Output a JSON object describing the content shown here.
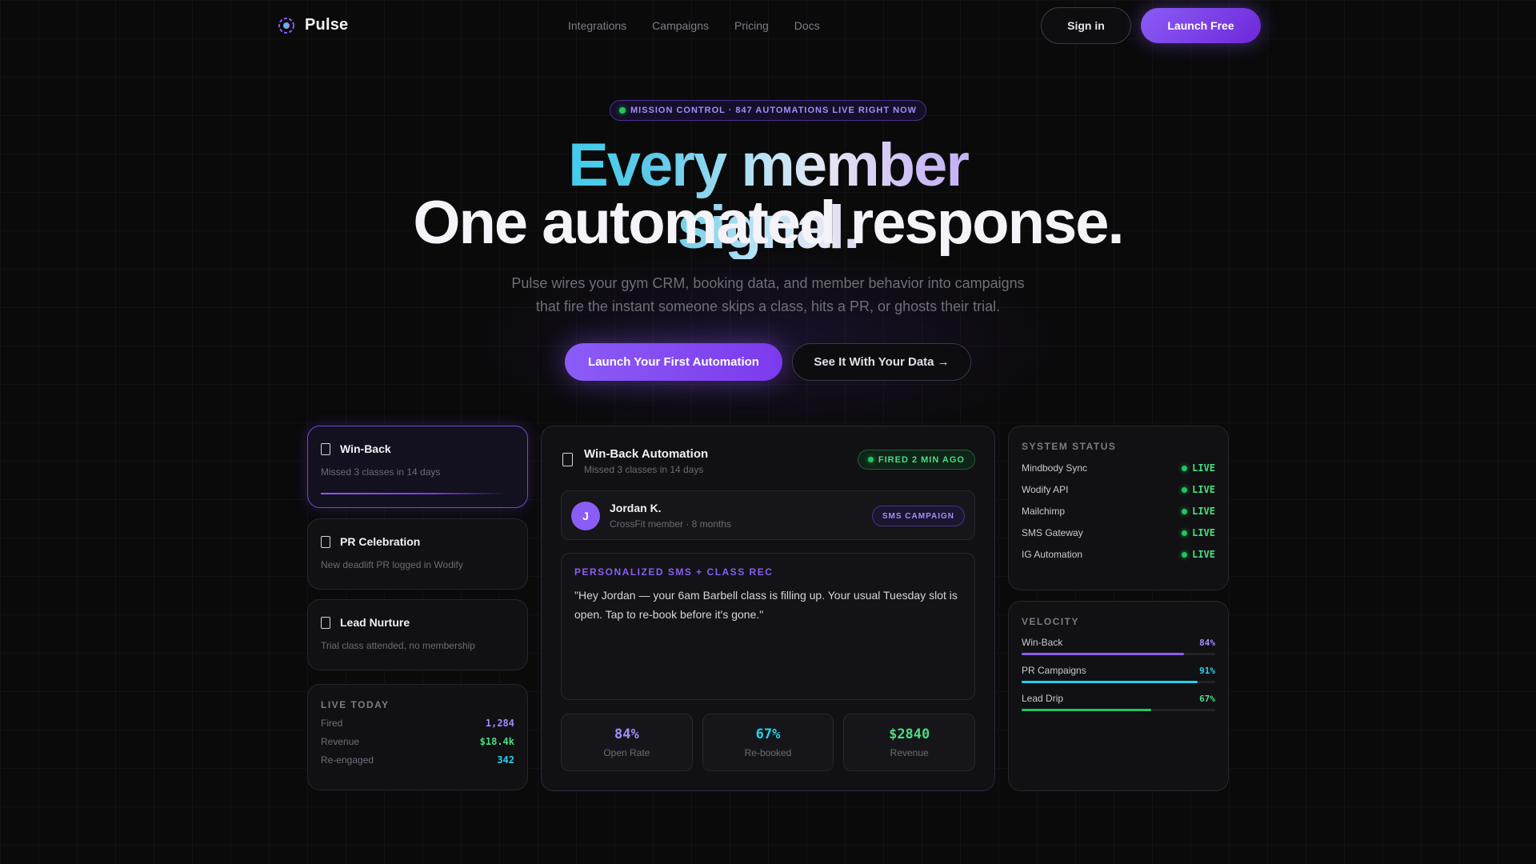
{
  "brand": {
    "name": "Pulse"
  },
  "nav": {
    "links": [
      "Integrations",
      "Campaigns",
      "Pricing",
      "Docs"
    ],
    "sign_in": "Sign in",
    "launch": "Launch Free"
  },
  "hero": {
    "badge": "MISSION CONTROL · 847 AUTOMATIONS LIVE RIGHT NOW",
    "headline_line1": "Every member signal.",
    "headline_line2": "One automated response.",
    "subtitle_line1": "Pulse wires your gym CRM, booking data, and member behavior into campaigns",
    "subtitle_line2": "that fire the instant someone skips a class, hits a PR, or ghosts their trial.",
    "cta_primary": "Launch Your First Automation",
    "cta_secondary": "See It With Your Data →"
  },
  "triggers": [
    {
      "title": "Win-Back",
      "desc": "Missed 3 classes in 14 days",
      "active": true
    },
    {
      "title": "PR Celebration",
      "desc": "New deadlift PR logged in Wodify",
      "active": false
    },
    {
      "title": "Lead Nurture",
      "desc": "Trial class attended, no membership",
      "active": false
    }
  ],
  "live_today": {
    "label": "LIVE TODAY",
    "rows": [
      {
        "label": "Fired",
        "value": "1,284",
        "color": "#a78bfa"
      },
      {
        "label": "Revenue",
        "value": "$18.4k",
        "color": "#4ade80"
      },
      {
        "label": "Re-engaged",
        "value": "342",
        "color": "#22d3ee"
      }
    ]
  },
  "automation": {
    "title": "Win-Back Automation",
    "subtitle": "Missed 3 classes in 14 days",
    "status": "FIRED 2 MIN AGO",
    "member": {
      "initial": "J",
      "name": "Jordan K.",
      "detail": "CrossFit member · 8 months",
      "tag": "SMS CAMPAIGN"
    },
    "message_label": "PERSONALIZED SMS + CLASS REC",
    "message": "\"Hey Jordan — your 6am Barbell class is filling up. Your usual Tuesday slot is open. Tap to re-book before it's gone.\"",
    "stats": [
      {
        "value": "84%",
        "label": "Open Rate",
        "color": "#a78bfa"
      },
      {
        "value": "67%",
        "label": "Re-booked",
        "color": "#22d3ee"
      },
      {
        "value": "$2840",
        "label": "Revenue",
        "color": "#4ade80"
      }
    ]
  },
  "system_status": {
    "label": "SYSTEM STATUS",
    "items": [
      {
        "name": "Mindbody Sync",
        "status": "LIVE"
      },
      {
        "name": "Wodify API",
        "status": "LIVE"
      },
      {
        "name": "Mailchimp",
        "status": "LIVE"
      },
      {
        "name": "SMS Gateway",
        "status": "LIVE"
      },
      {
        "name": "IG Automation",
        "status": "LIVE"
      }
    ]
  },
  "velocity": {
    "label": "VELOCITY",
    "items": [
      {
        "name": "Win-Back",
        "pct": "84%",
        "fraction": 0.84,
        "color": "#8b5cf6"
      },
      {
        "name": "PR Campaigns",
        "pct": "91%",
        "fraction": 0.91,
        "color": "#22d3ee"
      },
      {
        "name": "Lead Drip",
        "pct": "67%",
        "fraction": 0.67,
        "color": "#22c55e"
      }
    ]
  }
}
